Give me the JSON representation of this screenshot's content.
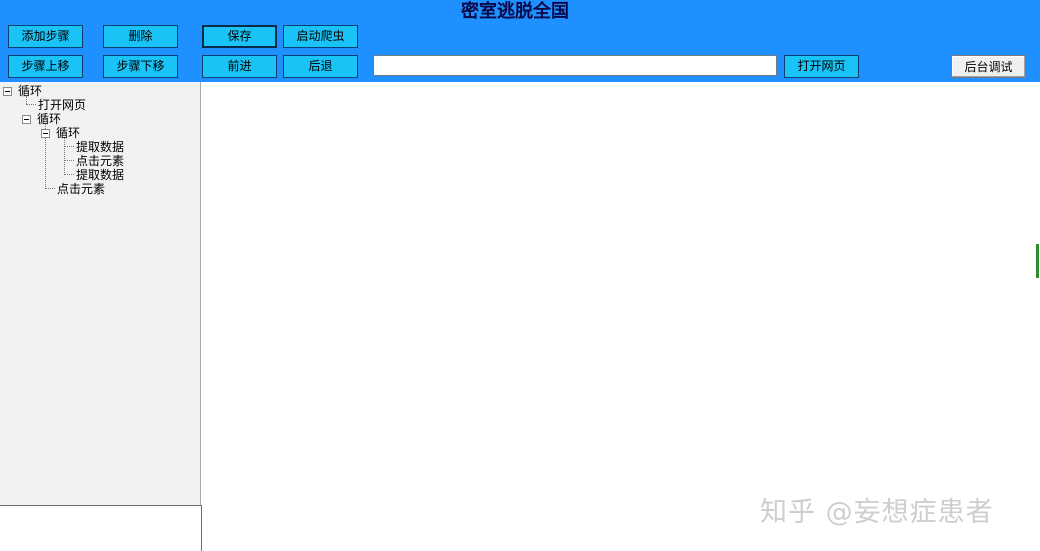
{
  "window": {
    "title": "密室逃脱全国"
  },
  "toolbar": {
    "add_step": "添加步骤",
    "delete": "删除",
    "save": "保存",
    "start_crawler": "启动爬虫",
    "step_up": "步骤上移",
    "step_down": "步骤下移",
    "forward": "前进",
    "back": "后退",
    "url_value": "",
    "open_page": "打开网页",
    "backend_debug": "后台调试"
  },
  "tree": [
    {
      "label": "循环",
      "expanded": true
    },
    {
      "label": "打开网页"
    },
    {
      "label": "循环",
      "expanded": true
    },
    {
      "label": "循环",
      "expanded": true
    },
    {
      "label": "提取数据"
    },
    {
      "label": "点击元素"
    },
    {
      "label": "提取数据"
    },
    {
      "label": "点击元素"
    }
  ],
  "watermark": "知乎 @妄想症患者",
  "colors": {
    "toolbar_bg": "#1e90ff",
    "button_bg": "#19c3f5",
    "panel_bg": "#f2f2f2"
  }
}
